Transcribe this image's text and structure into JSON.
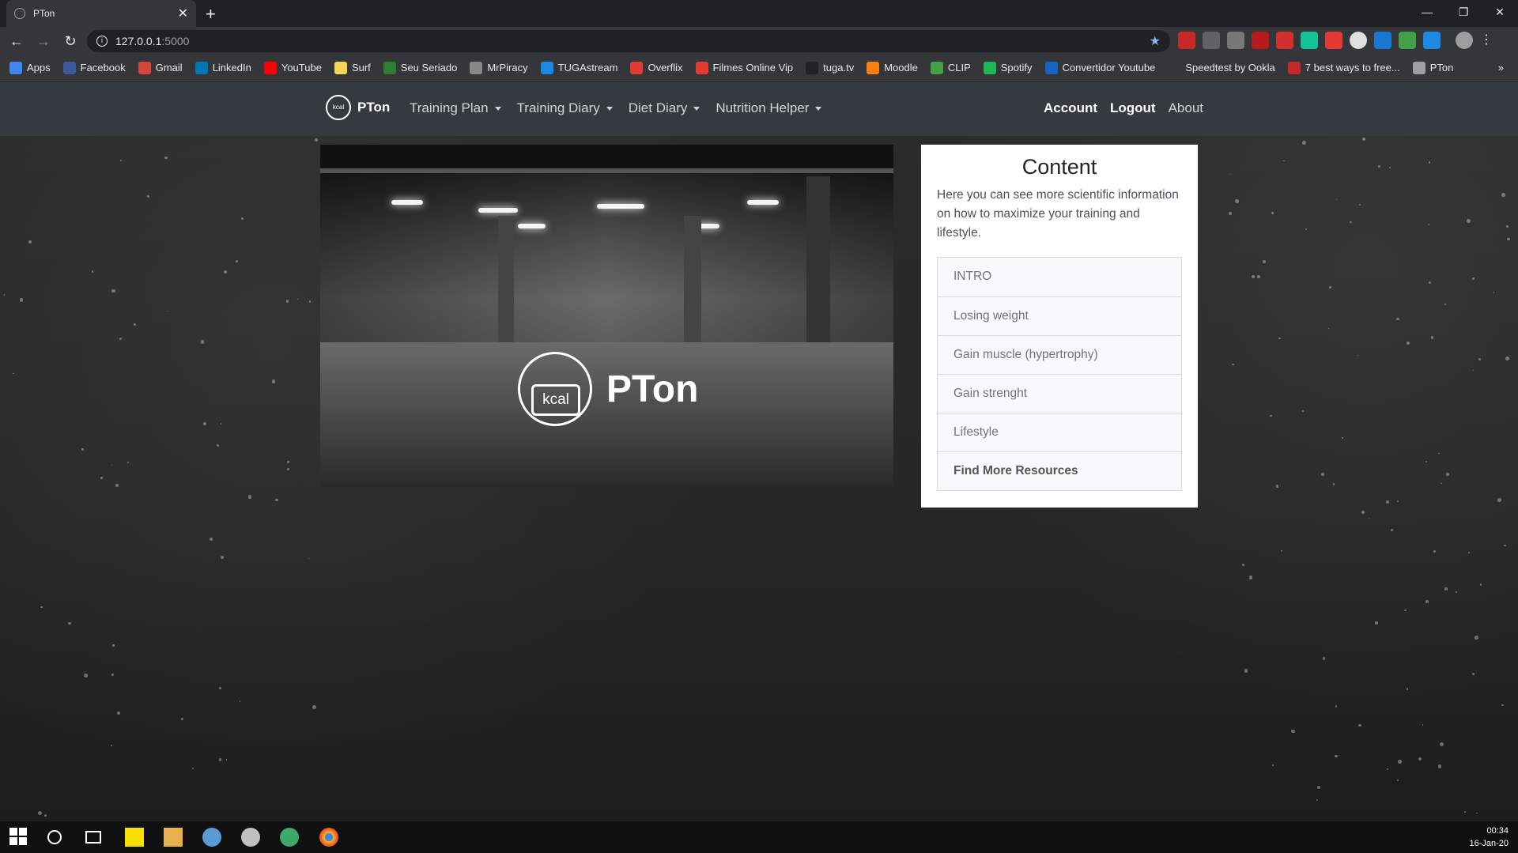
{
  "browser": {
    "tab_title": "PTon",
    "tab_close": "✕",
    "new_tab": "+",
    "url_host": "127.0.0.1",
    "url_port": ":5000",
    "window_controls": [
      "—",
      "❐",
      "✕"
    ]
  },
  "bookmarks": [
    {
      "label": "Apps",
      "color": "#4285f4"
    },
    {
      "label": "Facebook",
      "color": "#3b5998"
    },
    {
      "label": "Gmail",
      "color": "#d44638"
    },
    {
      "label": "LinkedIn",
      "color": "#0077b5"
    },
    {
      "label": "YouTube",
      "color": "#ff0000"
    },
    {
      "label": "Surf",
      "color": "#f6d55c"
    },
    {
      "label": "Seu Seriado",
      "color": "#2e7d32"
    },
    {
      "label": "MrPiracy",
      "color": "#888888"
    },
    {
      "label": "TUGAstream",
      "color": "#1e88e5"
    },
    {
      "label": "Overflix",
      "color": "#e53935"
    },
    {
      "label": "Filmes Online Vip",
      "color": "#e53935"
    },
    {
      "label": "tuga.tv",
      "color": "#222222"
    },
    {
      "label": "Moodle",
      "color": "#f98012"
    },
    {
      "label": "CLIP",
      "color": "#43a047"
    },
    {
      "label": "Spotify",
      "color": "#1db954"
    },
    {
      "label": "Convertidor Youtube",
      "color": "#1565c0"
    },
    {
      "label": "Speedtest by Ookla",
      "color": "#35363a"
    },
    {
      "label": "7 best ways to free...",
      "color": "#c62828"
    },
    {
      "label": "PTon",
      "color": "#9aa0a6"
    }
  ],
  "bookmarks_more": "»",
  "site": {
    "brand": "PTon",
    "logo_text": "kcal",
    "menu": [
      "Training Plan",
      "Training Diary",
      "Diet Diary",
      "Nutrition Helper"
    ],
    "account": "Account",
    "logout": "Logout",
    "about": "About"
  },
  "hero": {
    "logo_text": "kcal",
    "title": "PTon"
  },
  "content": {
    "heading": "Content",
    "description": "Here you can see more scientific information on how to maximize your training and lifestyle.",
    "items": [
      "INTRO",
      "Losing weight",
      "Gain muscle (hypertrophy)",
      "Gain strenght",
      "Lifestyle"
    ],
    "resources": "Find More Resources"
  },
  "taskbar": {
    "time": "00:34",
    "date": "16-Jan-20"
  }
}
